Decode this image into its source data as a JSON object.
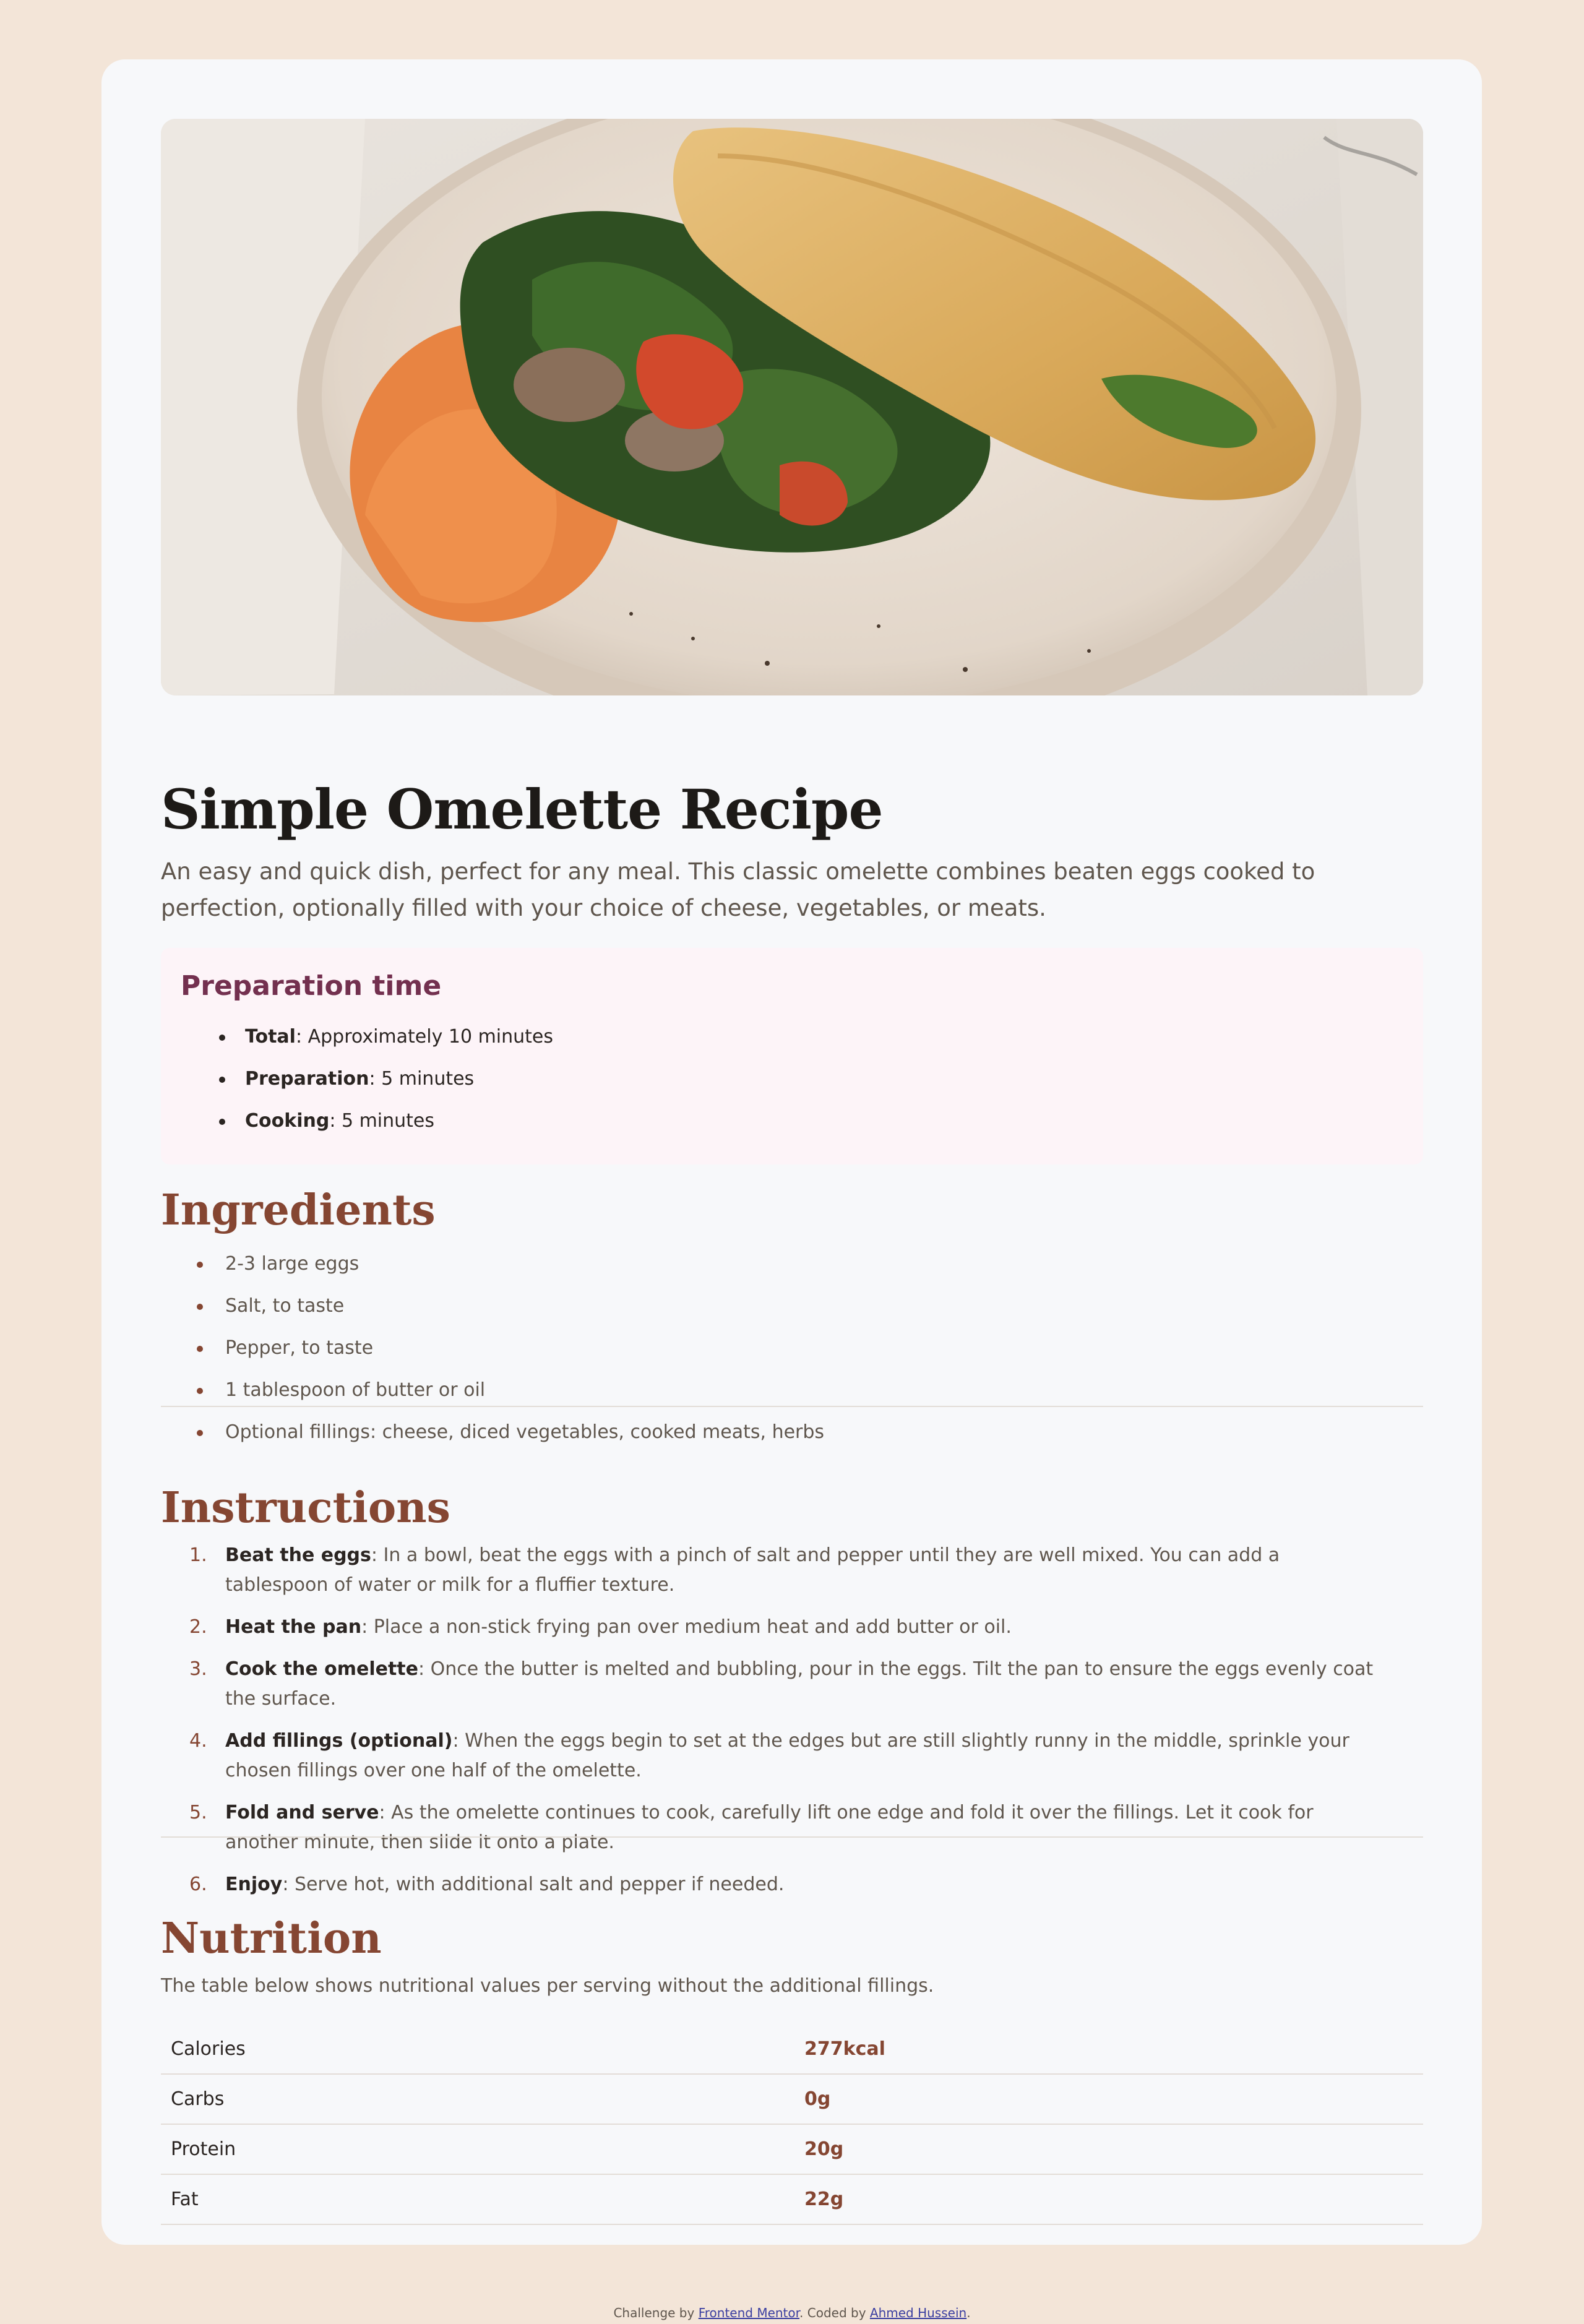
{
  "recipe": {
    "title": "Simple Omelette Recipe",
    "intro": "An easy and quick dish, perfect for any meal. This classic omelette combines beaten eggs cooked to perfection, optionally filled with your choice of cheese, vegetables, or meats."
  },
  "preparation": {
    "title": "Preparation time",
    "items": [
      {
        "label": "Total",
        "value": ": Approximately 10 minutes"
      },
      {
        "label": "Preparation",
        "value": ": 5 minutes"
      },
      {
        "label": "Cooking",
        "value": ": 5 minutes"
      }
    ]
  },
  "ingredients": {
    "title": "Ingredients",
    "items": [
      "2-3 large eggs",
      "Salt, to taste",
      "Pepper, to taste",
      "1 tablespoon of butter or oil",
      "Optional fillings: cheese, diced vegetables, cooked meats, herbs"
    ]
  },
  "instructions": {
    "title": "Instructions",
    "items": [
      {
        "num": "1.",
        "label": "Beat the eggs",
        "text": ": In a bowl, beat the eggs with a pinch of salt and pepper until they are well mixed. You can add a tablespoon of water or milk for a fluffier texture."
      },
      {
        "num": "2.",
        "label": "Heat the pan",
        "text": ": Place a non-stick frying pan over medium heat and add butter or oil."
      },
      {
        "num": "3.",
        "label": "Cook the omelette",
        "text": ": Once the butter is melted and bubbling, pour in the eggs. Tilt the pan to ensure the eggs evenly coat the surface."
      },
      {
        "num": "4.",
        "label": "Add fillings (optional)",
        "text": ": When the eggs begin to set at the edges but are still slightly runny in the middle, sprinkle your chosen fillings over one half of the omelette."
      },
      {
        "num": "5.",
        "label": "Fold and serve",
        "text": ": As the omelette continues to cook, carefully lift one edge and fold it over the fillings. Let it cook for another minute, then slide it onto a plate."
      },
      {
        "num": "6.",
        "label": "Enjoy",
        "text": ": Serve hot, with additional salt and pepper if needed."
      }
    ]
  },
  "nutrition": {
    "title": "Nutrition",
    "description": "The table below shows nutritional values per serving without the additional fillings.",
    "rows": [
      {
        "name": "Calories",
        "value": "277kcal"
      },
      {
        "name": "Carbs",
        "value": "0g"
      },
      {
        "name": "Protein",
        "value": "20g"
      },
      {
        "name": "Fat",
        "value": "22g"
      }
    ]
  },
  "footer": {
    "prefix": "Challenge by ",
    "link1": "Frontend Mentor",
    "middle": ". Coded by ",
    "link2": "Ahmed Hussein",
    "suffix": "."
  },
  "colors": {
    "background": "#f3e5d8",
    "card": "#f7f8fa",
    "accent_brown": "#854632",
    "accent_plum": "#73304f",
    "prep_bg": "#fdf4f8"
  },
  "hero_image": "omelette-on-plate-photo"
}
